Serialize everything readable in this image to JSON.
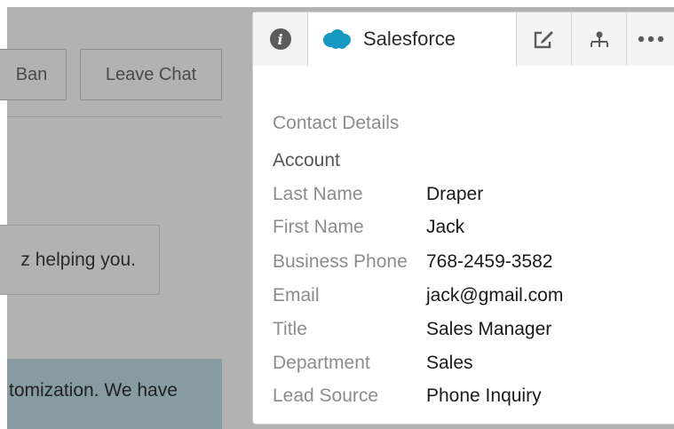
{
  "background_chat": {
    "ban_label": "Ban",
    "leave_chat_label": "Leave Chat",
    "message1_text": "z helping you.",
    "message2_text": "tomization. We have"
  },
  "panel": {
    "tabs": {
      "info_icon": "info-icon",
      "salesforce_label": "Salesforce",
      "edit_icon": "edit-icon",
      "org_icon": "org-chart-icon",
      "more_icon": "more-icon"
    },
    "contact": {
      "section_title": "Contact Details",
      "account_label": "Account",
      "fields": [
        {
          "label": "Last Name",
          "value": "Draper"
        },
        {
          "label": "First Name",
          "value": "Jack"
        },
        {
          "label": "Business Phone",
          "value": "768-2459-3582"
        },
        {
          "label": "Email",
          "value": "jack@gmail.com"
        },
        {
          "label": "Title",
          "value": "Sales Manager"
        },
        {
          "label": "Department",
          "value": "Sales"
        },
        {
          "label": "Lead Source",
          "value": "Phone Inquiry"
        }
      ]
    }
  },
  "colors": {
    "overlay": "#b2b2b2",
    "salesforce_blue": "#1798c1",
    "label_gray": "#8c8c8c"
  }
}
